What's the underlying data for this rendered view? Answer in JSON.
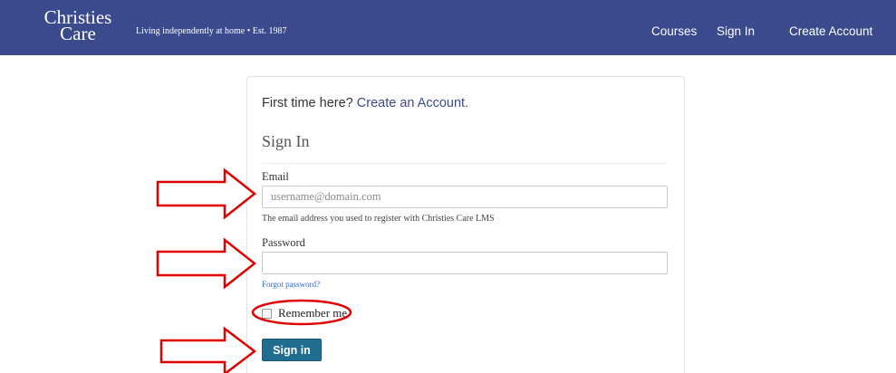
{
  "header": {
    "logo_line1": "Christies",
    "logo_line2": "Care",
    "tagline": "Living independently at home  •  Est. 1987",
    "nav": {
      "courses": "Courses",
      "sign_in": "Sign In",
      "create_account": "Create Account"
    }
  },
  "form": {
    "first_time_text": "First time here?",
    "create_account_link": "Create an Account.",
    "heading": "Sign In",
    "email_label": "Email",
    "email_placeholder": "username@domain.com",
    "email_value": "",
    "email_help": "The email address you used to register with Christies Care LMS",
    "password_label": "Password",
    "password_value": "",
    "forgot_password": "Forgot password?",
    "remember_me": "Remember me",
    "remember_checked": false,
    "submit_label": "Sign in"
  },
  "colors": {
    "header_bg": "#3a4a8c",
    "button_bg": "#1f6e8f",
    "annotation": "#e00000"
  }
}
